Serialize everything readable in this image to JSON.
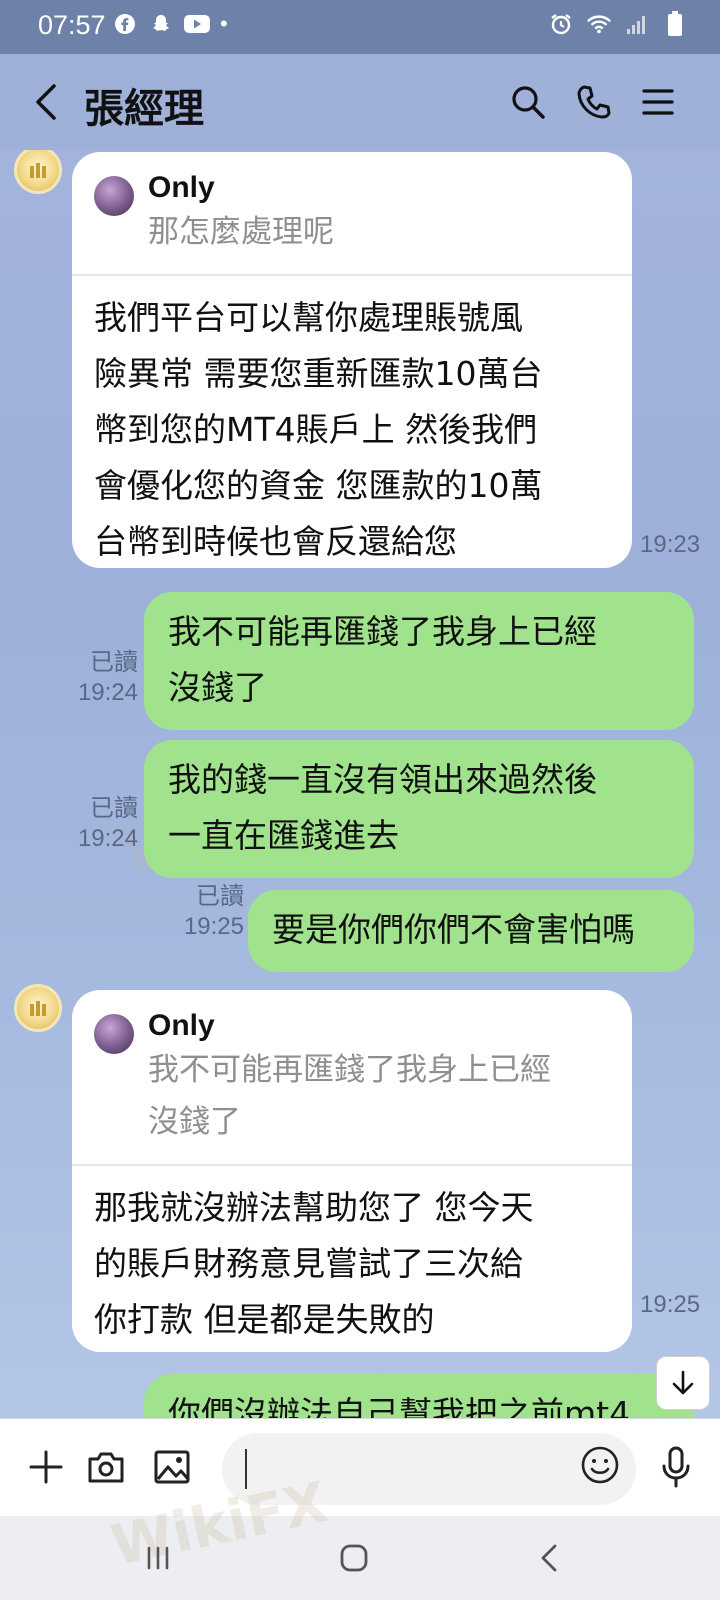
{
  "status_bar": {
    "time": "07:57",
    "dot": "•"
  },
  "header": {
    "title": "張經理"
  },
  "messages": {
    "m1": {
      "quote_name": "Only",
      "quote_text": "那怎麼處理呢",
      "body_lines": [
        "我們平台可以幫你處理賬號風",
        "險異常 需要您重新匯款10萬台",
        "幣到您的MT4賬戶上 然後我們",
        "會優化您的資金  您匯款的10萬",
        "台幣到時候也會反還給您"
      ],
      "time": "19:23"
    },
    "m2": {
      "lines": [
        "我不可能再匯錢了我身上已經",
        "沒錢了"
      ],
      "read": "已讀",
      "time": "19:24"
    },
    "m3": {
      "lines": [
        "我的錢一直沒有領出來過然後",
        "一直在匯錢進去"
      ],
      "read": "已讀",
      "time": "19:24"
    },
    "m4": {
      "text": "要是你們你們不會害怕嗎",
      "read": "已讀",
      "time": "19:25"
    },
    "m5": {
      "quote_name": "Only",
      "quote_lines": [
        "我不可能再匯錢了我身上已經",
        "沒錢了"
      ],
      "body_lines": [
        "那我就沒辦法幫助您了 您今天",
        "的賬戶財務意見嘗試了三次給",
        "你打款 但是都是失敗的"
      ],
      "time": "19:25"
    },
    "m6": {
      "text": "你們沒辦法自己幫我把之前mt4"
    }
  },
  "watermark": "WikiFX",
  "input": {
    "placeholder": ""
  }
}
